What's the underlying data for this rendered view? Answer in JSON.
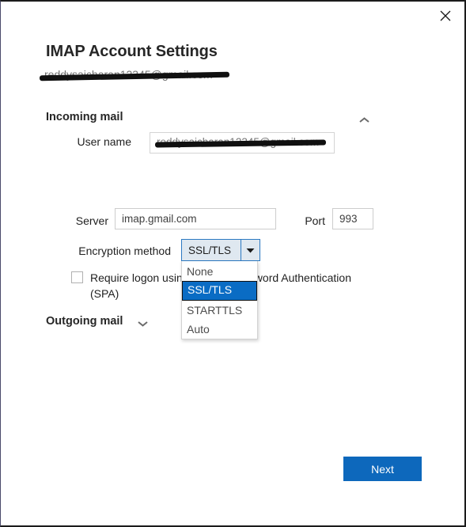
{
  "window": {
    "close_icon": "close-icon"
  },
  "header": {
    "title": "IMAP Account Settings",
    "account_email": "reddysaicharan12345@gmail.com"
  },
  "sections": {
    "incoming": {
      "label": "Incoming mail",
      "toggle_icon": "chevron-up-icon",
      "expanded": true
    },
    "outgoing": {
      "label": "Outgoing mail",
      "toggle_icon": "chevron-down-icon",
      "expanded": false
    }
  },
  "fields": {
    "username": {
      "label": "User name",
      "value": "reddysaicharan12345@gmail.com",
      "redacted": true
    },
    "server": {
      "label": "Server",
      "value": "imap.gmail.com",
      "placeholder": "Server"
    },
    "port": {
      "label": "Port",
      "value": "993",
      "placeholder": "Port"
    },
    "encryption": {
      "label": "Encryption method",
      "selected": "SSL/TLS",
      "dropdown_open": true,
      "arrow_icon": "chevron-down-icon",
      "options": [
        {
          "label": "None",
          "selected": false
        },
        {
          "label": "SSL/TLS",
          "selected": true
        },
        {
          "label": "STARTTLS",
          "selected": false
        },
        {
          "label": "Auto",
          "selected": false
        }
      ]
    },
    "spa": {
      "label": "Require logon using Secure Password Authentication (SPA)",
      "checked": false
    }
  },
  "footer": {
    "next_label": "Next"
  },
  "colors": {
    "accent_blue": "#0d68bc",
    "highlight_blue": "#0a6cc4",
    "combo_border": "#2b79c2",
    "combo_fill": "#dfe8f0",
    "text_primary": "#1f1f1f",
    "redaction": "#111111"
  }
}
